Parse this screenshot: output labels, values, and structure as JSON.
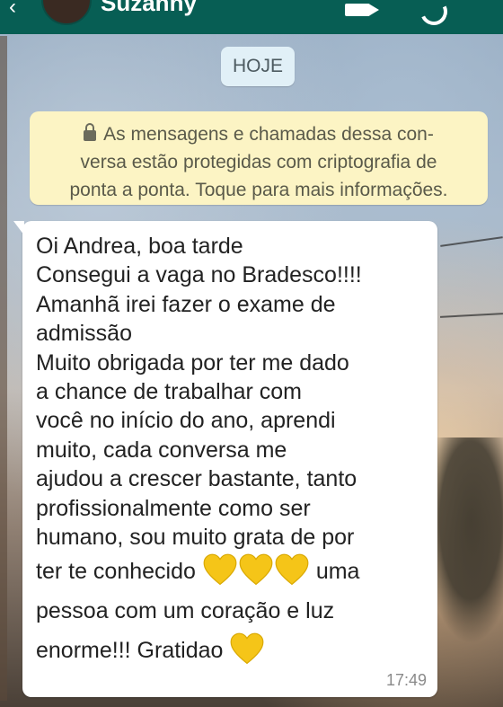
{
  "header": {
    "contact_name": "Suzanny",
    "back_icon": "back-arrow-icon",
    "video_icon": "video-call-icon",
    "call_icon": "phone-call-icon"
  },
  "chat": {
    "date_chip": "HOJE",
    "encryption_notice": {
      "icon": "lock-icon",
      "lines": [
        "As mensagens e chamadas dessa con-",
        "versa estão protegidas com criptografia de",
        "ponta a ponta. Toque para mais informações."
      ]
    },
    "message": {
      "lines": [
        "Oi Andrea, boa tarde",
        "Consegui a vaga no Bradesco!!!!",
        "Amanhã irei fazer o exame de",
        "admissão",
        "Muito obrigada por ter me dado",
        "a chance de trabalhar com",
        "você  no início do ano, aprendi",
        "muito, cada conversa me",
        "ajudou a crescer bastante, tanto",
        "profissionalmente como ser",
        "humano, sou muito grata de  por"
      ],
      "line_hearts_before": "ter te conhecido",
      "line_hearts_after": "uma",
      "line_after_hearts": "pessoa com um coração e luz",
      "last_line": "enorme!!! Gratidao",
      "emoji": "yellow-heart-icon",
      "time": "17:49"
    }
  },
  "colors": {
    "header": "#075e54",
    "encryption_bg": "#fcf4c4",
    "date_chip_bg": "#e1f0f7",
    "bubble_bg": "#ffffff",
    "heart": "#f5c518"
  }
}
